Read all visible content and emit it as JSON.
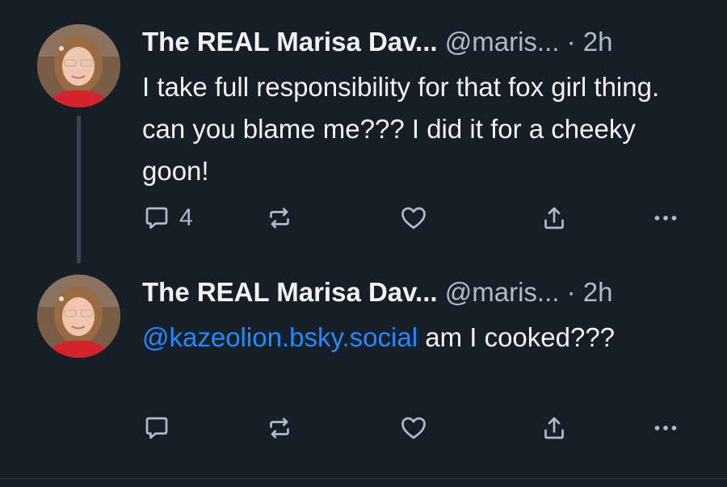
{
  "colors": {
    "background": "#161e27",
    "text_primary": "#f1f3f5",
    "text_secondary": "#aebbc9",
    "mention": "#208bfe",
    "thread_line": "#3a4653"
  },
  "posts": [
    {
      "display_name": "The REAL Marisa Dav...",
      "handle": "@maris...",
      "separator": "·",
      "time": "2h",
      "text": "I take full responsibility for that fox girl thing. can you blame me??? I did it for a cheeky goon!",
      "reply_count": "4",
      "icons": [
        "avatar",
        "reply-icon",
        "repost-icon",
        "like-icon",
        "share-icon",
        "more-icon"
      ]
    },
    {
      "display_name": "The REAL Marisa Dav...",
      "handle": "@maris...",
      "separator": "·",
      "time": "2h",
      "mention": "@kazeolion.bsky.social",
      "text": " am I cooked???",
      "icons": [
        "avatar",
        "reply-icon",
        "repost-icon",
        "like-icon",
        "share-icon",
        "more-icon"
      ]
    }
  ]
}
